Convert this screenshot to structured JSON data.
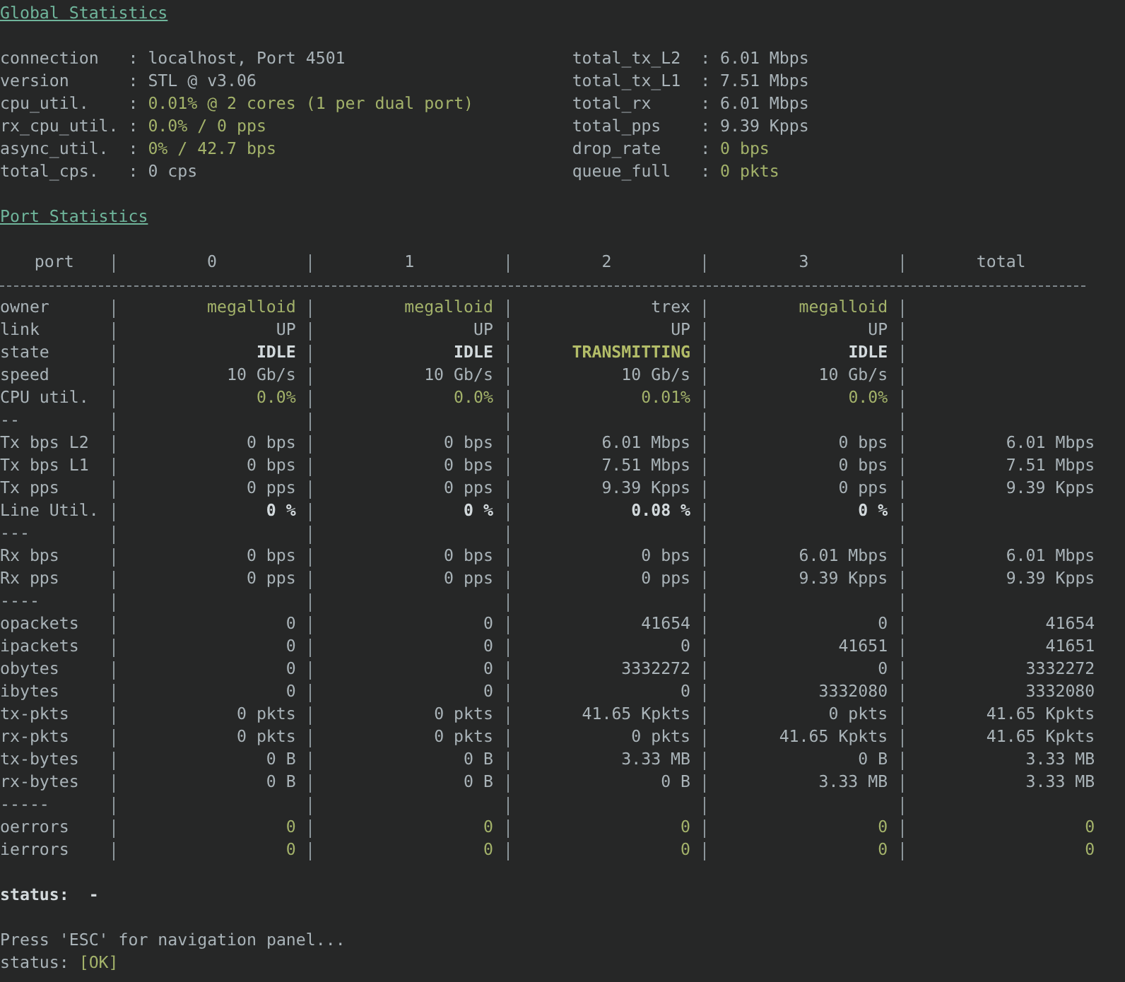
{
  "global_statistics": {
    "title": "Global Statistics",
    "left": [
      {
        "label": "connection",
        "sep": ":",
        "value": "localhost, Port 4501",
        "kind": "plain"
      },
      {
        "label": "version",
        "sep": ":",
        "value": "STL @ v3.06",
        "kind": "plain"
      },
      {
        "label": "cpu_util.",
        "sep": ":",
        "value": "0.01% @ 2 cores (1 per dual port)",
        "kind": "good"
      },
      {
        "label": "rx_cpu_util.",
        "sep": ":",
        "value": "0.0% / 0 pps",
        "kind": "good"
      },
      {
        "label": "async_util.",
        "sep": ":",
        "value": "0% / 42.7 bps",
        "kind": "good"
      },
      {
        "label": "total_cps.",
        "sep": ":",
        "value": "0 cps",
        "kind": "plain"
      }
    ],
    "right": [
      {
        "label": "total_tx_L2",
        "sep": ":",
        "value": "6.01 Mbps",
        "kind": "plain"
      },
      {
        "label": "total_tx_L1",
        "sep": ":",
        "value": "7.51 Mbps",
        "kind": "plain"
      },
      {
        "label": "total_rx",
        "sep": ":",
        "value": "6.01 Mbps",
        "kind": "plain"
      },
      {
        "label": "total_pps",
        "sep": ":",
        "value": "9.39 Kpps",
        "kind": "plain"
      },
      {
        "label": "drop_rate",
        "sep": ":",
        "value": "0 bps",
        "kind": "good"
      },
      {
        "label": "queue_full",
        "sep": ":",
        "value": "0 pkts",
        "kind": "good"
      }
    ]
  },
  "port_statistics": {
    "title": "Port Statistics",
    "columns": [
      "port",
      "0",
      "1",
      "2",
      "3",
      "total"
    ],
    "rows": [
      {
        "label": "owner",
        "kind": "good",
        "cells": [
          {
            "text": "megalloid",
            "kind": "good"
          },
          {
            "text": "megalloid",
            "kind": "good"
          },
          {
            "text": "trex",
            "kind": "plain"
          },
          {
            "text": "megalloid",
            "kind": "good"
          }
        ]
      },
      {
        "label": "link",
        "kind": "plain",
        "cells": [
          "UP",
          "UP",
          "UP",
          "UP"
        ]
      },
      {
        "label": "state",
        "kind": "plain",
        "cells": [
          {
            "text": "IDLE",
            "kind": "bold"
          },
          {
            "text": "IDLE",
            "kind": "bold"
          },
          {
            "text": "TRANSMITTING",
            "kind": "active"
          },
          {
            "text": "IDLE",
            "kind": "bold"
          }
        ]
      },
      {
        "label": "speed",
        "kind": "plain",
        "cells": [
          "10 Gb/s",
          "10 Gb/s",
          "10 Gb/s",
          "10 Gb/s"
        ]
      },
      {
        "label": "CPU util.",
        "kind": "good",
        "cells": [
          "0.0%",
          "0.0%",
          "0.01%",
          "0.0%"
        ]
      },
      {
        "label": "--",
        "kind": "plain",
        "cells": []
      },
      {
        "label": "Tx bps L2",
        "kind": "plain",
        "cells": [
          "0 bps",
          "0 bps",
          "6.01 Mbps",
          "0 bps",
          "6.01 Mbps"
        ]
      },
      {
        "label": "Tx bps L1",
        "kind": "plain",
        "cells": [
          "0 bps",
          "0 bps",
          "7.51 Mbps",
          "0 bps",
          "7.51 Mbps"
        ]
      },
      {
        "label": "Tx pps",
        "kind": "plain",
        "cells": [
          "0 pps",
          "0 pps",
          "9.39 Kpps",
          "0 pps",
          "9.39 Kpps"
        ]
      },
      {
        "label": "Line Util.",
        "kind": "bold",
        "cells": [
          "0 %",
          "0 %",
          "0.08 %",
          "0 %"
        ]
      },
      {
        "label": "---",
        "kind": "plain",
        "cells": []
      },
      {
        "label": "Rx bps",
        "kind": "plain",
        "cells": [
          "0 bps",
          "0 bps",
          "0 bps",
          "6.01 Mbps",
          "6.01 Mbps"
        ]
      },
      {
        "label": "Rx pps",
        "kind": "plain",
        "cells": [
          "0 pps",
          "0 pps",
          "0 pps",
          "9.39 Kpps",
          "9.39 Kpps"
        ]
      },
      {
        "label": "----",
        "kind": "plain",
        "cells": []
      },
      {
        "label": "opackets",
        "kind": "plain",
        "cells": [
          "0",
          "0",
          "41654",
          "0",
          "41654"
        ]
      },
      {
        "label": "ipackets",
        "kind": "plain",
        "cells": [
          "0",
          "0",
          "0",
          "41651",
          "41651"
        ]
      },
      {
        "label": "obytes",
        "kind": "plain",
        "cells": [
          "0",
          "0",
          "3332272",
          "0",
          "3332272"
        ]
      },
      {
        "label": "ibytes",
        "kind": "plain",
        "cells": [
          "0",
          "0",
          "0",
          "3332080",
          "3332080"
        ]
      },
      {
        "label": "tx-pkts",
        "kind": "plain",
        "cells": [
          "0 pkts",
          "0 pkts",
          "41.65 Kpkts",
          "0 pkts",
          "41.65 Kpkts"
        ]
      },
      {
        "label": "rx-pkts",
        "kind": "plain",
        "cells": [
          "0 pkts",
          "0 pkts",
          "0 pkts",
          "41.65 Kpkts",
          "41.65 Kpkts"
        ]
      },
      {
        "label": "tx-bytes",
        "kind": "plain",
        "cells": [
          "0 B",
          "0 B",
          "3.33 MB",
          "0 B",
          "3.33 MB"
        ]
      },
      {
        "label": "rx-bytes",
        "kind": "plain",
        "cells": [
          "0 B",
          "0 B",
          "0 B",
          "3.33 MB",
          "3.33 MB"
        ]
      },
      {
        "label": "-----",
        "kind": "plain",
        "cells": []
      },
      {
        "label": "oerrors",
        "kind": "good",
        "cells": [
          "0",
          "0",
          "0",
          "0",
          "0"
        ]
      },
      {
        "label": "ierrors",
        "kind": "good",
        "cells": [
          "0",
          "0",
          "0",
          "0",
          "0"
        ]
      }
    ]
  },
  "status": {
    "label": "status:",
    "value": "-"
  },
  "footer": {
    "hint": "Press 'ESC' for navigation panel...",
    "status_label": "status:",
    "status_value": "[OK]"
  }
}
